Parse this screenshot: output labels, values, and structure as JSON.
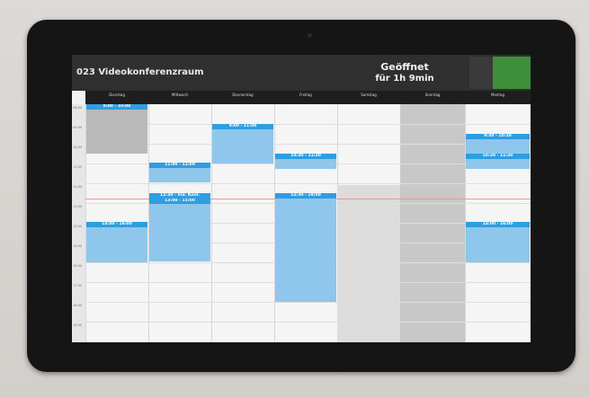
{
  "header": {
    "room_title": "023 Videokonferenzraum",
    "room_subtitle": "",
    "status_title": "Geöffnet",
    "status_subtitle": "für 1h 9min"
  },
  "days": [
    {
      "name": "Dienstag",
      "date": ""
    },
    {
      "name": "Mittwoch",
      "date": ""
    },
    {
      "name": "Donnerstag",
      "date": ""
    },
    {
      "name": "Freitag",
      "date": ""
    },
    {
      "name": "Samstag",
      "date": ""
    },
    {
      "name": "Sonntag",
      "date": ""
    },
    {
      "name": "Montag",
      "date": ""
    }
  ],
  "times": [
    "08:00",
    "09:00",
    "10:00",
    "11:00",
    "12:00",
    "13:00",
    "14:00",
    "15:00",
    "16:00",
    "17:00",
    "18:00",
    "19:00"
  ],
  "events": {
    "tue_morning": {
      "time": "8:00 - 10:00",
      "text": ""
    },
    "tue_afternoon": {
      "time": "14:00 - 16:00",
      "text": ""
    },
    "wed_1": {
      "time": "11:00 - 12:00",
      "text": ""
    },
    "wed_2a": {
      "time": "12:30 - Vid. Konf.",
      "text": ""
    },
    "wed_2b": {
      "time": "13:00 - 15:00",
      "text": ""
    },
    "thu_1": {
      "time": "9:00 - 11:00",
      "text": ""
    },
    "fri_1": {
      "time": "10:30 - 11:30",
      "text": ""
    },
    "fri_2": {
      "time": "12:30 - 19:00",
      "text": ""
    },
    "mon_1": {
      "time": "9:30 - 10:30",
      "text": ""
    },
    "mon_2": {
      "time": "10:30 - 11:30",
      "text": ""
    },
    "mon_3": {
      "time": "14:00 - 16:00",
      "text": ""
    }
  },
  "colors": {
    "event_header": "#2f9ee0",
    "event_body": "#8fc7ec",
    "status_open": "#3f8f3a",
    "header_bg": "#2f2f2f"
  }
}
